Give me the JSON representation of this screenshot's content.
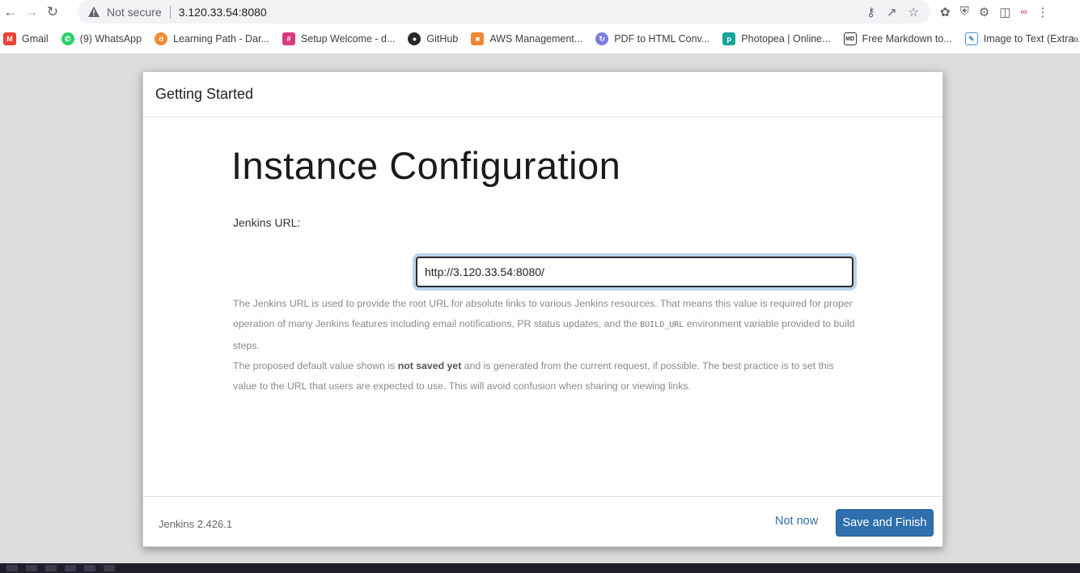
{
  "browser": {
    "security_text": "Not secure",
    "url": "3.120.33.54:8080"
  },
  "bookmarks": [
    {
      "label": "Gmail",
      "icon": "gmail-icon",
      "color": "#ea4335"
    },
    {
      "label": "(9) WhatsApp",
      "icon": "whatsapp-icon",
      "color": "#25d366"
    },
    {
      "label": "Learning Path - Dar...",
      "icon": "learning-path-icon",
      "color": "#f08c2e"
    },
    {
      "label": "Setup Welcome - d...",
      "icon": "slack-icon",
      "color": "#d9397b"
    },
    {
      "label": "GitHub",
      "icon": "github-icon",
      "color": "#24292e"
    },
    {
      "label": "AWS Management...",
      "icon": "aws-icon",
      "color": "#f58534"
    },
    {
      "label": "PDF to HTML Conv...",
      "icon": "pdf-convert-icon",
      "color": "#7b7be0"
    },
    {
      "label": "Photopea | Online...",
      "icon": "photopea-icon",
      "color": "#18a497"
    },
    {
      "label": "Free Markdown to...",
      "icon": "markdown-icon",
      "color": "#333333"
    },
    {
      "label": "Image to Text (Extra...",
      "icon": "image-to-text-icon",
      "color": "#4a8fd8"
    }
  ],
  "modal": {
    "header_title": "Getting Started",
    "page_title": "Instance Configuration",
    "url_label": "Jenkins URL:",
    "url_value": "http://3.120.33.54:8080/",
    "help_p1_before": "The Jenkins URL is used to provide the root URL for absolute links to various Jenkins resources. That means this value is required for proper operation of many Jenkins features including email notifications, PR status updates, and the ",
    "help_p1_code": "BUILD_URL",
    "help_p1_after": " environment variable provided to build steps.",
    "help_p2_before": "The proposed default value shown is ",
    "help_p2_bold": "not saved yet",
    "help_p2_after": " and is generated from the current request, if possible. The best practice is to set this value to the URL that users are expected to use. This will avoid confusion when sharing or viewing links.",
    "version": "Jenkins 2.426.1",
    "not_now_label": "Not now",
    "save_label": "Save and Finish"
  },
  "colors": {
    "primary_button": "#2f6fad",
    "link": "#2f6fa8",
    "focus_ring": "#b9d3ea"
  }
}
